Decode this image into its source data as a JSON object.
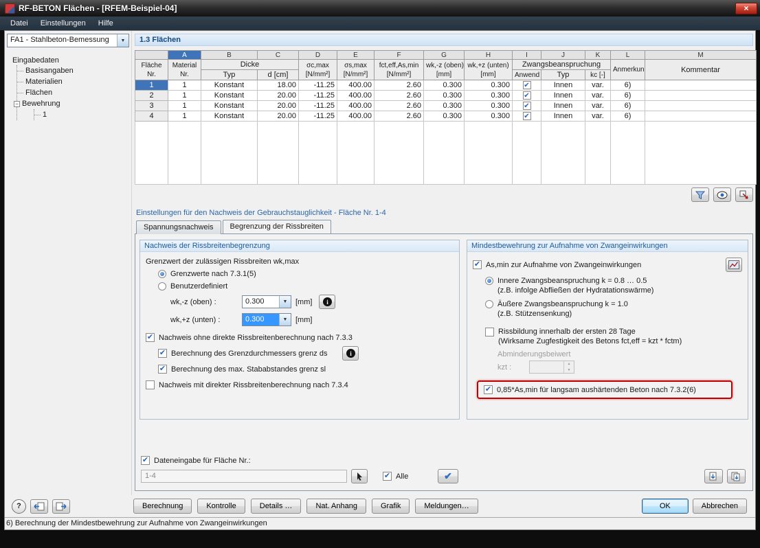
{
  "colors": {
    "selection_blue": "#3f74b8",
    "highlight_red": "#c00000",
    "heading_blue": "#1a5a9e",
    "combo_focus": "#3597ff"
  },
  "icons": {
    "close": "×",
    "dropdown": "▼",
    "check": "✔",
    "collapse": "−",
    "info": "i",
    "help": "?",
    "spin_up": "▲",
    "spin_down": "▼"
  },
  "window": {
    "title": "RF-BETON Flächen - [RFEM-Beispiel-04]",
    "menu": [
      "Datei",
      "Einstellungen",
      "Hilfe"
    ]
  },
  "sidebar": {
    "case": "FA1 - Stahlbeton-Bemessung",
    "tree_root": "Eingabedaten",
    "tree_items": [
      "Basisangaben",
      "Materialien",
      "Flächen",
      "Bewehrung"
    ],
    "tree_child": "1"
  },
  "main": {
    "section_title": "1.3 Flächen",
    "settings_title": "Einstellungen für den Nachweis der Gebrauchstauglichkeit - Fläche Nr. 1-4",
    "tab_stress": "Spannungsnachweis",
    "tab_crack": "Begrenzung der Rissbreiten"
  },
  "table": {
    "letters": [
      "A",
      "B",
      "C",
      "D",
      "E",
      "F",
      "G",
      "H",
      "I",
      "J",
      "K",
      "L",
      "M"
    ],
    "headers": {
      "flaeche1": "Fläche",
      "flaeche2": "Nr.",
      "material1": "Material",
      "material2": "Nr.",
      "dicke": "Dicke",
      "typ": "Typ",
      "d": "d [cm]",
      "sigc": "σc,max",
      "sigs": "σs,max",
      "fct": "fct,eff,As,min",
      "unit_nmm2": "[N/mm²]",
      "unit_mm": "[mm]",
      "wkz": "wk,-z (oben)",
      "wkp": "wk,+z (unten)",
      "zwang": "Zwangsbeanspruchung",
      "anwend": "Anwend",
      "ztyp": "Typ",
      "kc": "kc [-]",
      "anmerkung": "Anmerkun",
      "kommentar": "Kommentar"
    },
    "rows": [
      {
        "nr": "1",
        "material": "1",
        "typ": "Konstant",
        "d": "18.00",
        "sc": "-11.25",
        "ss": "400.00",
        "fct": "2.60",
        "wkz": "0.300",
        "wkp": "0.300",
        "anwend": true,
        "ztyp": "Innen",
        "kc": "var.",
        "anm": "6)",
        "komm": ""
      },
      {
        "nr": "2",
        "material": "1",
        "typ": "Konstant",
        "d": "20.00",
        "sc": "-11.25",
        "ss": "400.00",
        "fct": "2.60",
        "wkz": "0.300",
        "wkp": "0.300",
        "anwend": true,
        "ztyp": "Innen",
        "kc": "var.",
        "anm": "6)",
        "komm": ""
      },
      {
        "nr": "3",
        "material": "1",
        "typ": "Konstant",
        "d": "20.00",
        "sc": "-11.25",
        "ss": "400.00",
        "fct": "2.60",
        "wkz": "0.300",
        "wkp": "0.300",
        "anwend": true,
        "ztyp": "Innen",
        "kc": "var.",
        "anm": "6)",
        "komm": ""
      },
      {
        "nr": "4",
        "material": "1",
        "typ": "Konstant",
        "d": "20.00",
        "sc": "-11.25",
        "ss": "400.00",
        "fct": "2.60",
        "wkz": "0.300",
        "wkp": "0.300",
        "anwend": true,
        "ztyp": "Innen",
        "kc": "var.",
        "anm": "6)",
        "komm": ""
      }
    ]
  },
  "crack_panel": {
    "title": "Nachweis der Rissbreitenbegrenzung",
    "limit_label": "Grenzwert der zulässigen Rissbreiten wk,max",
    "radio_code": "Grenzwerte nach 7.3.1(5)",
    "radio_user": "Benutzerdefiniert",
    "wkz_label": "wk,-z (oben) :",
    "wkz_value": "0.300",
    "wkp_label": "wk,+z (unten) :",
    "wkp_value": "0.300",
    "unit_mm": "[mm]",
    "cb_nodirect": "Nachweis ohne direkte Rissbreitenberechnung nach 7.3.3",
    "cb_diameter": "Berechnung des Grenzdurchmessers  grenz ds",
    "cb_spacing": "Berechnung des max. Stababstandes grenz sl",
    "cb_direct": "Nachweis mit direkter Rissbreitenberechnung nach 7.3.4"
  },
  "minreinf_panel": {
    "title": "Mindestbewehrung zur Aufnahme von Zwangeinwirkungen",
    "cb_asmin": "As,min zur Aufnahme von Zwangeinwirkungen",
    "radio_inner_1": "Innere Zwangsbeanspruchung k = 0.8 … 0.5",
    "radio_inner_2": "(z.B. infolge Abfließen der Hydratationswärme)",
    "radio_outer_1": "Äußere Zwangsbeanspruchung k = 1.0",
    "radio_outer_2": "(z.B. Stützensenkung)",
    "cb_28_1": "Rissbildung innerhalb der ersten 28 Tage",
    "cb_28_2": "(Wirksame Zugfestigkeit des Betons fct,eff = kzt * fctm)",
    "reduction_label": "Abminderungsbeiwert",
    "kzt_label": "kzt :",
    "cb_slow": "0,85*As,min für langsam aushärtenden Beton nach 7.3.2(6)"
  },
  "data_entry": {
    "label": "Dateneingabe für Fläche Nr.:",
    "value": "1-4",
    "alle": "Alle"
  },
  "footer": {
    "buttons": [
      "Berechnung",
      "Kontrolle",
      "Details …",
      "Nat. Anhang",
      "Grafik",
      "Meldungen…"
    ],
    "ok": "OK",
    "cancel": "Abbrechen",
    "status": "6) Berechnung der Mindestbewehrung zur Aufnahme von Zwangeinwirkungen"
  }
}
